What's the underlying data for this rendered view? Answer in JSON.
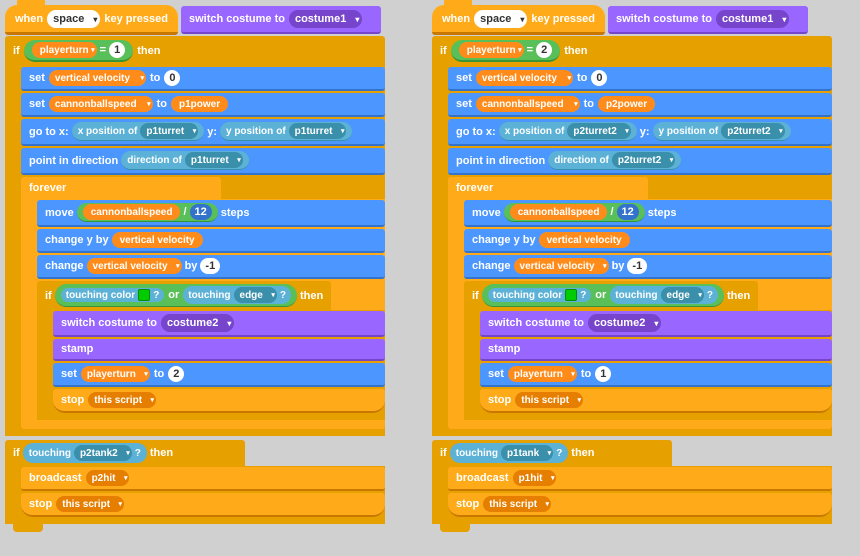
{
  "left_script": {
    "hat": "when space ▾ key pressed",
    "blocks": [
      {
        "type": "purple",
        "text": "switch costume to",
        "dropdown": "costume1"
      },
      {
        "type": "if_block",
        "condition": "playerturn = 1",
        "then": true
      },
      {
        "type": "set_var",
        "var": "vertical velocity",
        "to": "0"
      },
      {
        "type": "set_var",
        "var": "cannonballspeed",
        "to": "p1power"
      },
      {
        "type": "goto",
        "x_of": "p1turret",
        "y_of": "p1turret"
      },
      {
        "type": "point",
        "direction_of": "p1turret"
      },
      {
        "type": "forever"
      },
      {
        "type": "move_steps"
      },
      {
        "type": "change_y"
      },
      {
        "type": "change_vel"
      },
      {
        "type": "if_touch"
      },
      {
        "type": "switch_costume2"
      },
      {
        "type": "stamp"
      },
      {
        "type": "set_playerturn_2"
      },
      {
        "type": "stop_this"
      }
    ]
  },
  "right_script": {
    "hat": "when space ▾ key pressed",
    "blocks": []
  },
  "labels": {
    "when": "when",
    "space": "space",
    "key_pressed": "key pressed",
    "switch_costume": "switch costume to",
    "costume1": "costume1",
    "if": "if",
    "then": "then",
    "playerturn": "playerturn",
    "eq1": "= 1",
    "eq2": "= 2",
    "set": "set",
    "vertical_velocity": "vertical velocity",
    "to": "to",
    "zero": "0",
    "cannonballspeed": "cannonballspeed",
    "p1power": "p1power",
    "p2power": "p2power",
    "goto_x": "go to x:",
    "x_position": "x position",
    "of": "of",
    "p1turret": "p1turret",
    "p2turret2": "p2turret2",
    "y": "y:",
    "y_position": "y position",
    "point_dir": "point in direction",
    "direction": "direction",
    "forever": "forever",
    "move": "move",
    "div12": "/ 12",
    "steps": "steps",
    "change_y_by": "change y by",
    "change": "change",
    "by_neg1": "by -1",
    "touching_color": "touching color",
    "question": "?",
    "or": "or",
    "touching_edge": "touching edge",
    "switch_costume2": "switch costume to",
    "costume2": "costume2",
    "stamp": "stamp",
    "set_playerturn": "set playerturn ▾ to",
    "val2": "2",
    "val1": "1",
    "stop_this_script": "stop this script",
    "if_touching": "if",
    "touching_p2tank": "touching p2tank2",
    "touching_p1tank": "touching p1tank",
    "broadcast": "broadcast",
    "p2hit": "p2hit",
    "p1hit": "p1hit"
  }
}
